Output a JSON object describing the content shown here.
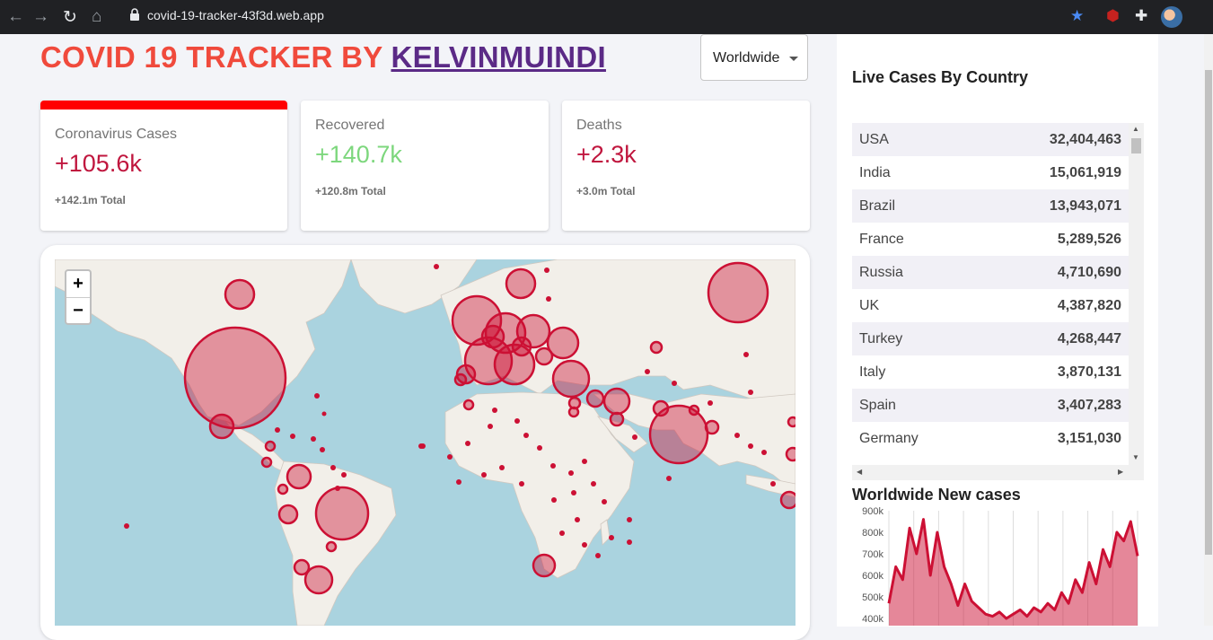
{
  "browser": {
    "url": "covid-19-tracker-43f3d.web.app"
  },
  "header": {
    "title_prefix": "COVID 19 TRACKER BY ",
    "title_link": "KELVINMUINDI",
    "country_select": "Worldwide"
  },
  "stats": [
    {
      "label": "Coronavirus Cases",
      "today": "+105.6k",
      "total": "+142.1m Total",
      "color": "#c0163e"
    },
    {
      "label": "Recovered",
      "today": "+140.7k",
      "total": "+120.8m Total",
      "color": "#7dd77d"
    },
    {
      "label": "Deaths",
      "today": "+2.3k",
      "total": "+3.0m Total",
      "color": "#c0163e"
    }
  ],
  "map": {
    "zoom_in": "+",
    "zoom_out": "−",
    "water_color": "#aad3df",
    "land_color": "#f2efe9",
    "circle_color": "#cc1034"
  },
  "sidebar": {
    "title": "Live Cases By Country",
    "countries": [
      {
        "name": "USA",
        "cases": "32,404,463"
      },
      {
        "name": "India",
        "cases": "15,061,919"
      },
      {
        "name": "Brazil",
        "cases": "13,943,071"
      },
      {
        "name": "France",
        "cases": "5,289,526"
      },
      {
        "name": "Russia",
        "cases": "4,710,690"
      },
      {
        "name": "UK",
        "cases": "4,387,820"
      },
      {
        "name": "Turkey",
        "cases": "4,268,447"
      },
      {
        "name": "Italy",
        "cases": "3,870,131"
      },
      {
        "name": "Spain",
        "cases": "3,407,283"
      },
      {
        "name": "Germany",
        "cases": "3,151,030"
      }
    ],
    "chart_title": "Worldwide New cases"
  },
  "chart_data": {
    "type": "area",
    "title": "Worldwide New cases",
    "y_ticks": [
      "900k",
      "800k",
      "700k",
      "600k",
      "500k",
      "400k"
    ],
    "ylim": [
      400000,
      900000
    ],
    "grid": true,
    "values": [
      470000,
      640000,
      580000,
      820000,
      700000,
      860000,
      600000,
      800000,
      640000,
      560000,
      460000,
      560000,
      480000,
      450000,
      420000,
      410000,
      430000,
      400000,
      420000,
      440000,
      410000,
      450000,
      430000,
      470000,
      440000,
      520000,
      470000,
      580000,
      520000,
      660000,
      560000,
      720000,
      640000,
      800000,
      760000,
      850000,
      690000
    ]
  }
}
